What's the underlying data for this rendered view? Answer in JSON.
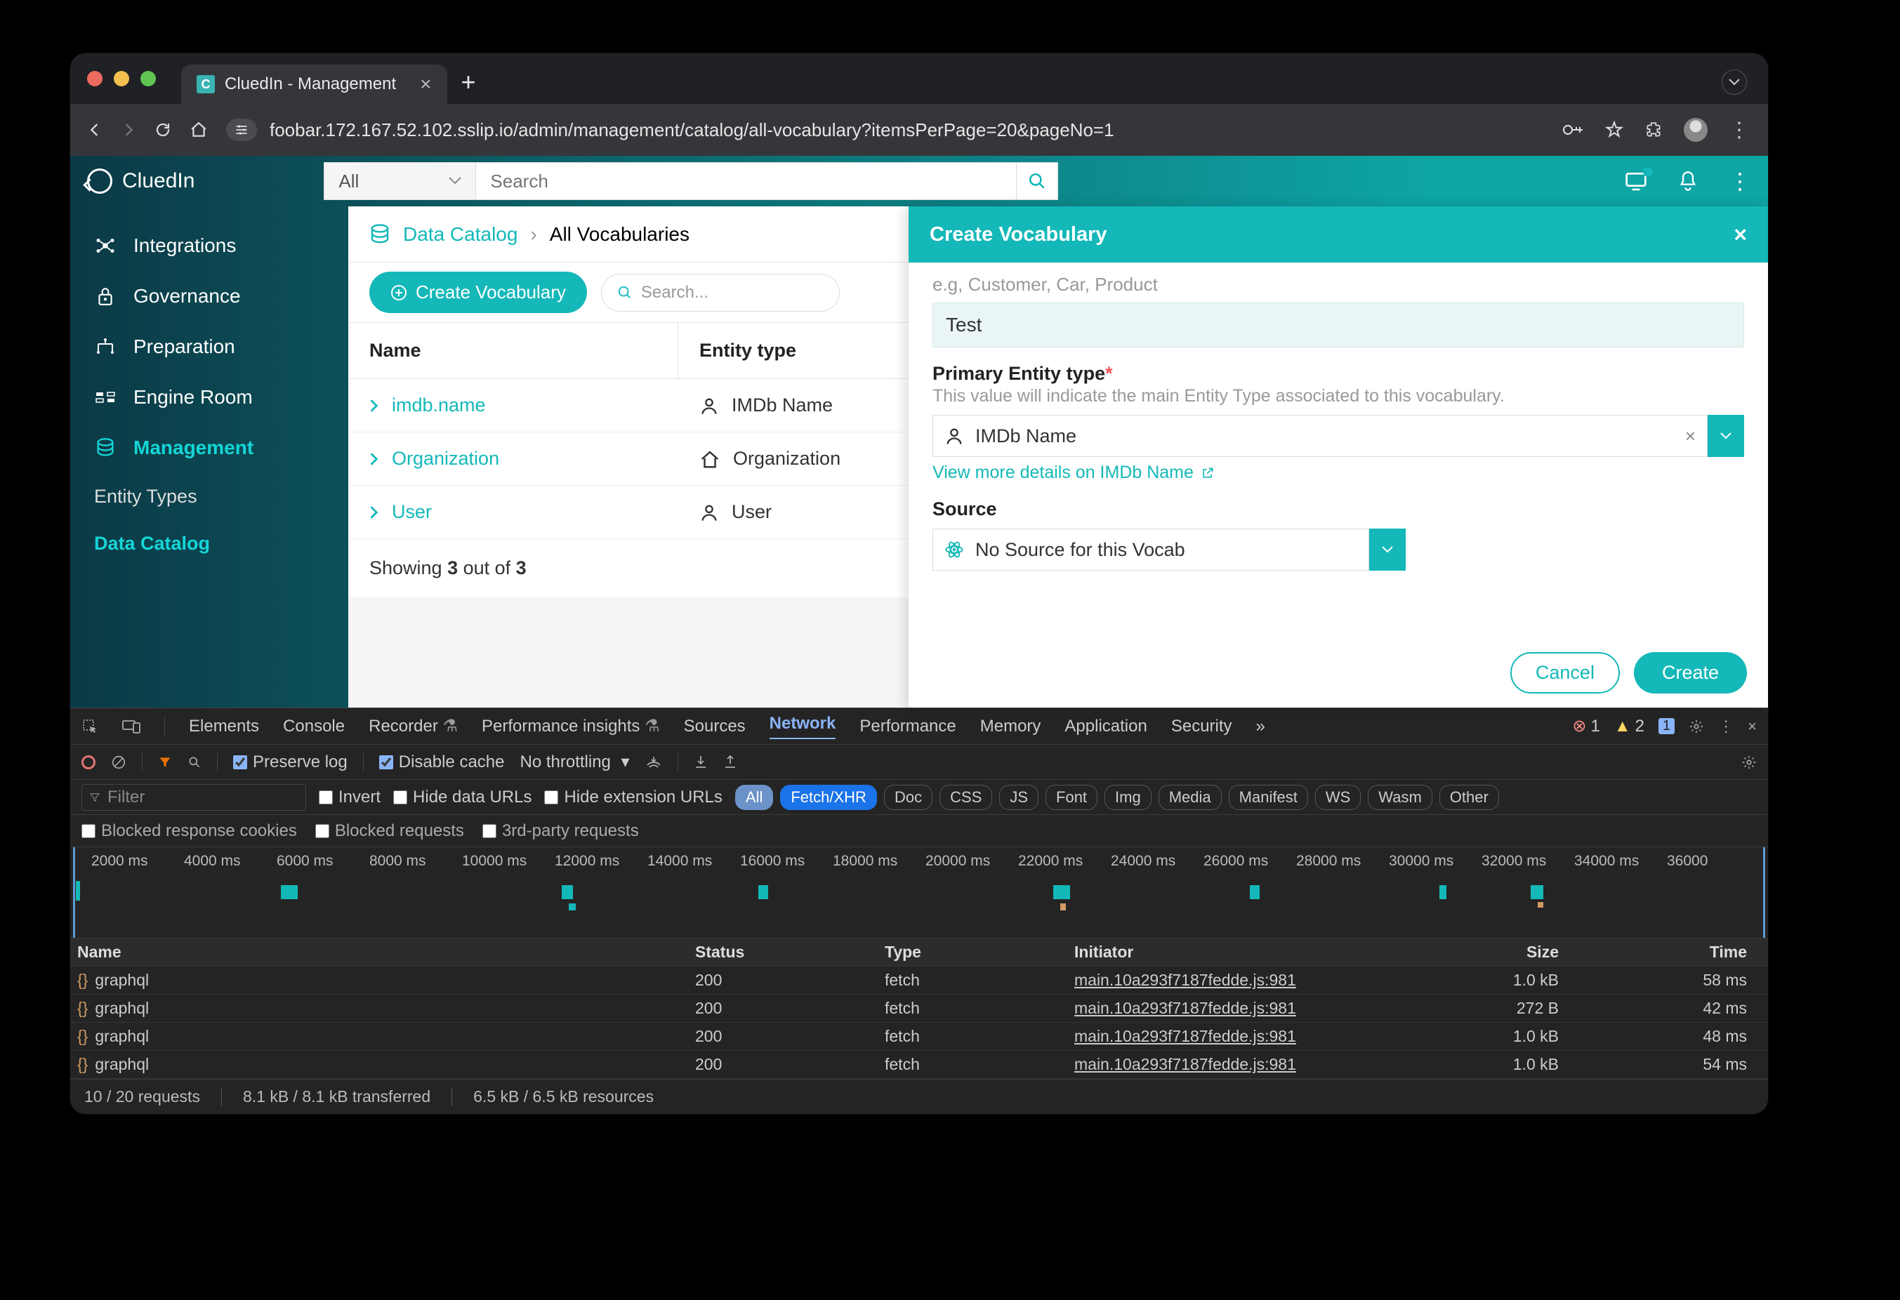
{
  "browser": {
    "tab_title": "CluedIn - Management",
    "url": "foobar.172.167.52.102.sslip.io/admin/management/catalog/all-vocabulary?itemsPerPage=20&pageNo=1"
  },
  "app": {
    "brand": "CluedIn",
    "search_scope": "All",
    "search_placeholder": "Search",
    "sidebar": [
      {
        "label": "Integrations"
      },
      {
        "label": "Governance"
      },
      {
        "label": "Preparation"
      },
      {
        "label": "Engine Room"
      },
      {
        "label": "Management",
        "active": true
      }
    ],
    "subnav": [
      {
        "label": "Entity Types"
      },
      {
        "label": "Data Catalog",
        "active": true
      }
    ],
    "breadcrumb": {
      "root": "Data Catalog",
      "current": "All Vocabularies"
    },
    "create_btn": "Create Vocabulary",
    "list_search_placeholder": "Search...",
    "columns": {
      "c1": "Name",
      "c2": "Entity type"
    },
    "rows": [
      {
        "name": "imdb.name",
        "entity": "IMDb Name",
        "icon": "person"
      },
      {
        "name": "Organization",
        "entity": "Organization",
        "icon": "house"
      },
      {
        "name": "User",
        "entity": "User",
        "icon": "person"
      }
    ],
    "footer": {
      "pre": "Showing ",
      "b1": "3",
      "mid": " out of ",
      "b2": "3"
    }
  },
  "modal": {
    "title": "Create Vocabulary",
    "hint": "e.g, Customer, Car, Product",
    "name_value": "Test",
    "entity_label": "Primary Entity type",
    "entity_desc": "This value will indicate the main Entity Type associated to this vocabulary.",
    "entity_value": "IMDb Name",
    "entity_link": "View more details on IMDb Name",
    "source_label": "Source",
    "source_value": "No Source for this Vocab",
    "cancel": "Cancel",
    "create": "Create"
  },
  "devtools": {
    "tabs": [
      "Elements",
      "Console",
      "Recorder",
      "Performance insights",
      "Sources",
      "Network",
      "Performance",
      "Memory",
      "Application",
      "Security"
    ],
    "active_tab": "Network",
    "errors": "1",
    "warnings": "2",
    "infos": "1",
    "preserve": "Preserve log",
    "disable": "Disable cache",
    "throttle": "No throttling",
    "filters": {
      "filter": "Filter",
      "invert": "Invert",
      "hide_urls": "Hide data URLs",
      "hide_ext": "Hide extension URLs"
    },
    "types": [
      "All",
      "Fetch/XHR",
      "Doc",
      "CSS",
      "JS",
      "Font",
      "Img",
      "Media",
      "Manifest",
      "WS",
      "Wasm",
      "Other"
    ],
    "row2": [
      "Blocked response cookies",
      "Blocked requests",
      "3rd-party requests"
    ],
    "timeline": [
      "2000 ms",
      "4000 ms",
      "6000 ms",
      "8000 ms",
      "10000 ms",
      "12000 ms",
      "14000 ms",
      "16000 ms",
      "18000 ms",
      "20000 ms",
      "22000 ms",
      "24000 ms",
      "26000 ms",
      "28000 ms",
      "30000 ms",
      "32000 ms",
      "34000 ms",
      "36000"
    ],
    "columns": {
      "name": "Name",
      "status": "Status",
      "type": "Type",
      "initiator": "Initiator",
      "size": "Size",
      "time": "Time"
    },
    "rows": [
      {
        "name": "graphql",
        "status": "200",
        "type": "fetch",
        "initiator": "main.10a293f7187fedde.js:981",
        "size": "1.0 kB",
        "time": "58 ms"
      },
      {
        "name": "graphql",
        "status": "200",
        "type": "fetch",
        "initiator": "main.10a293f7187fedde.js:981",
        "size": "272 B",
        "time": "42 ms"
      },
      {
        "name": "graphql",
        "status": "200",
        "type": "fetch",
        "initiator": "main.10a293f7187fedde.js:981",
        "size": "1.0 kB",
        "time": "48 ms"
      },
      {
        "name": "graphql",
        "status": "200",
        "type": "fetch",
        "initiator": "main.10a293f7187fedde.js:981",
        "size": "1.0 kB",
        "time": "54 ms"
      }
    ],
    "status": {
      "req": "10 / 20 requests",
      "trans": "8.1 kB / 8.1 kB transferred",
      "res": "6.5 kB / 6.5 kB resources"
    }
  }
}
